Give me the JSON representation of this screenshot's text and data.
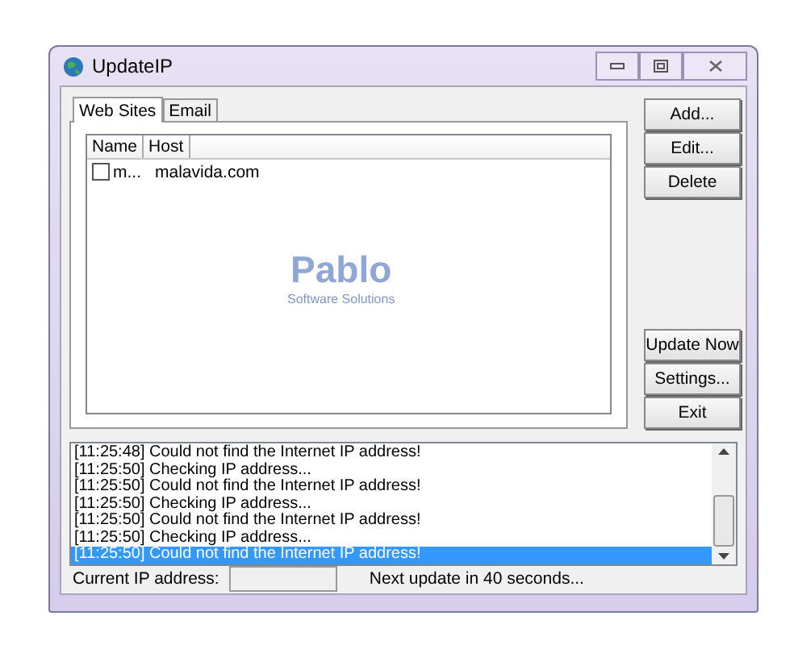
{
  "window": {
    "title": "UpdateIP"
  },
  "tabs": [
    {
      "label": "Web Sites",
      "selected": true
    },
    {
      "label": "Email",
      "selected": false
    }
  ],
  "table": {
    "columns": [
      "Name",
      "Host"
    ],
    "rows": [
      {
        "name": "m...",
        "host": "malavida.com",
        "checked": false
      }
    ]
  },
  "logo": {
    "title": "Pablo",
    "subtitle": "Software Solutions"
  },
  "buttons": [
    {
      "label": "Add...",
      "kind": "top"
    },
    {
      "label": "Edit...",
      "kind": "top"
    },
    {
      "label": "Delete",
      "kind": "top"
    },
    {
      "label": "Update Now",
      "kind": "bottom"
    },
    {
      "label": "Settings...",
      "kind": "bottom"
    },
    {
      "label": "Exit",
      "kind": "bottom"
    }
  ],
  "log": [
    {
      "text": "[11:25:48] Could not find the Internet IP address!",
      "selected": false
    },
    {
      "text": "[11:25:50] Checking IP address...",
      "selected": false
    },
    {
      "text": "[11:25:50] Could not find the Internet IP address!",
      "selected": false
    },
    {
      "text": "[11:25:50] Checking IP address...",
      "selected": false
    },
    {
      "text": "[11:25:50] Could not find the Internet IP address!",
      "selected": false
    },
    {
      "text": "[11:25:50] Checking IP address...",
      "selected": false
    },
    {
      "text": "[11:25:50] Could not find the Internet IP address!",
      "selected": true
    }
  ],
  "status": {
    "ip_label": "Current IP address:",
    "next_update": "Next update in 40 seconds..."
  }
}
